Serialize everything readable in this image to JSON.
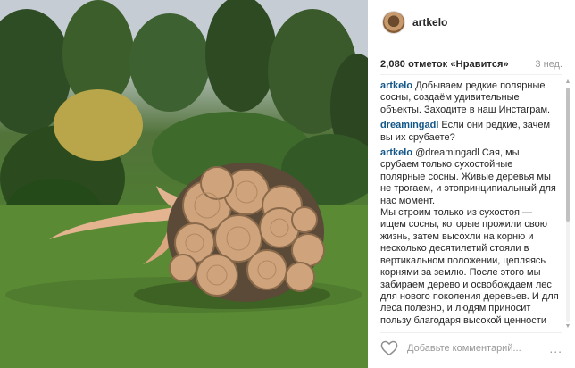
{
  "post": {
    "username": "artkelo",
    "likes": "2,080 отметок «Нравится»",
    "time": "3 нед."
  },
  "comments": [
    {
      "user": "artkelo",
      "text": "Добываем редкие полярные сосны, создаём удивительные объекты. Заходите в наш Инстаграм."
    },
    {
      "user": "dreamingadl",
      "text": "Если они редкие, зачем вы их срубаете?"
    },
    {
      "user": "artkelo",
      "text": "@dreamingadl Сая, мы срубаем только сухостойные полярные сосны. Живые деревья мы не трогаем, и этопринципиальный для нас момент.\nМы строим только из сухостоя — ищем сосны, которые прожили свою жизнь, затем высохли на корню и несколько десятилетий стояли в вертикальном положении, цепляясь корнями за землю. После этого мы забираем дерево и освобождаем лес для нового поколения деревьев. И для леса полезно, и людям приносит пользу благодаря высокой ценности таких стволов."
    }
  ],
  "footer": {
    "add_comment_placeholder": "Добавьте комментарий...",
    "more": "..."
  },
  "icons": {
    "like": "heart-outline-icon",
    "more": "ellipsis-icon"
  },
  "colors": {
    "username_link": "#125688",
    "text": "#262626",
    "muted": "#999999"
  }
}
